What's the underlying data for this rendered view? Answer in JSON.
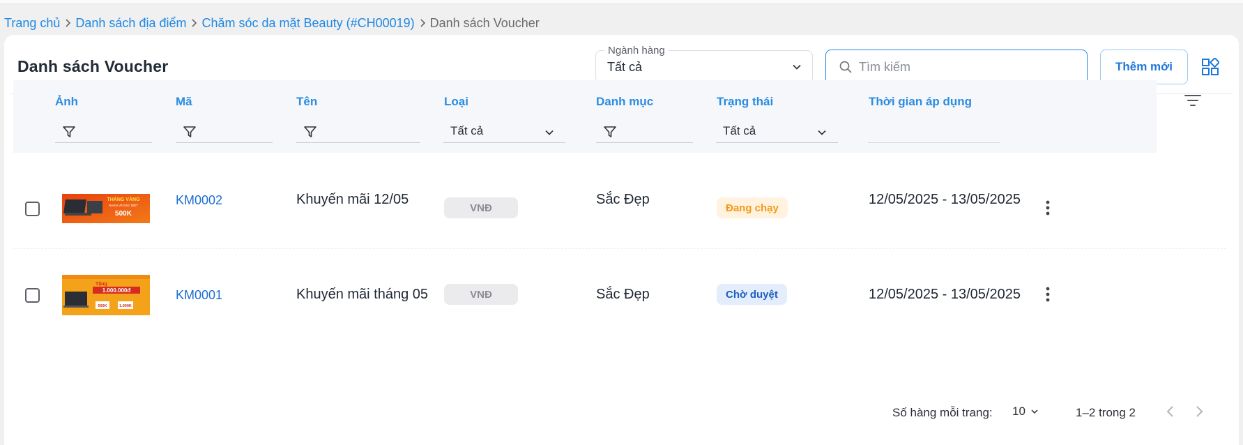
{
  "breadcrumb": {
    "items": [
      {
        "label": "Trang chủ"
      },
      {
        "label": "Danh sách địa điểm"
      },
      {
        "label": "Chăm sóc da mặt Beauty (#CH00019)"
      }
    ],
    "current": "Danh sách Voucher"
  },
  "header": {
    "title": "Danh sách Voucher",
    "industry_select": {
      "label": "Ngành hàng",
      "value": "Tất cả"
    },
    "search": {
      "placeholder": "Tìm kiếm"
    },
    "add_button": "Thêm mới"
  },
  "table": {
    "columns": {
      "image": "Ảnh",
      "code": "Mã",
      "name": "Tên",
      "type": "Loại",
      "category": "Danh mục",
      "status": "Trạng thái",
      "period": "Thời gian áp dụng"
    },
    "filters": {
      "type": "Tất cả",
      "status": "Tất cả"
    },
    "rows": [
      {
        "code": "KM0002",
        "name": "Khuyến mãi 12/05",
        "type": "VNĐ",
        "category": "Sắc Đẹp",
        "status": "Đang chạy",
        "period": "12/05/2025 - 13/05/2025",
        "thumb": {
          "headline": "THÁNG VÀNG",
          "sub": "NHẬN VÉ ĐẶC BIỆT",
          "amount": "500K"
        }
      },
      {
        "code": "KM0001",
        "name": "Khuyến mãi tháng 05",
        "type": "VNĐ",
        "category": "Sắc Đẹp",
        "status": "Chờ duyệt",
        "period": "12/05/2025 - 13/05/2025",
        "thumb": {
          "headline": "Tặng",
          "amount": "1.000.000đ",
          "chip_a": "500K",
          "chip_b": "1.000K"
        }
      }
    ]
  },
  "pagination": {
    "rows_per_page_label": "Số hàng mỗi trang:",
    "rows_per_page": "10",
    "range": "1–2 trong 2"
  },
  "colors": {
    "accent": "#1e88e5",
    "status_running_text": "#f19a18",
    "status_running_bg": "#fff3e0",
    "status_pending_text": "#1e5fbf",
    "status_pending_bg": "#e3edfc"
  }
}
